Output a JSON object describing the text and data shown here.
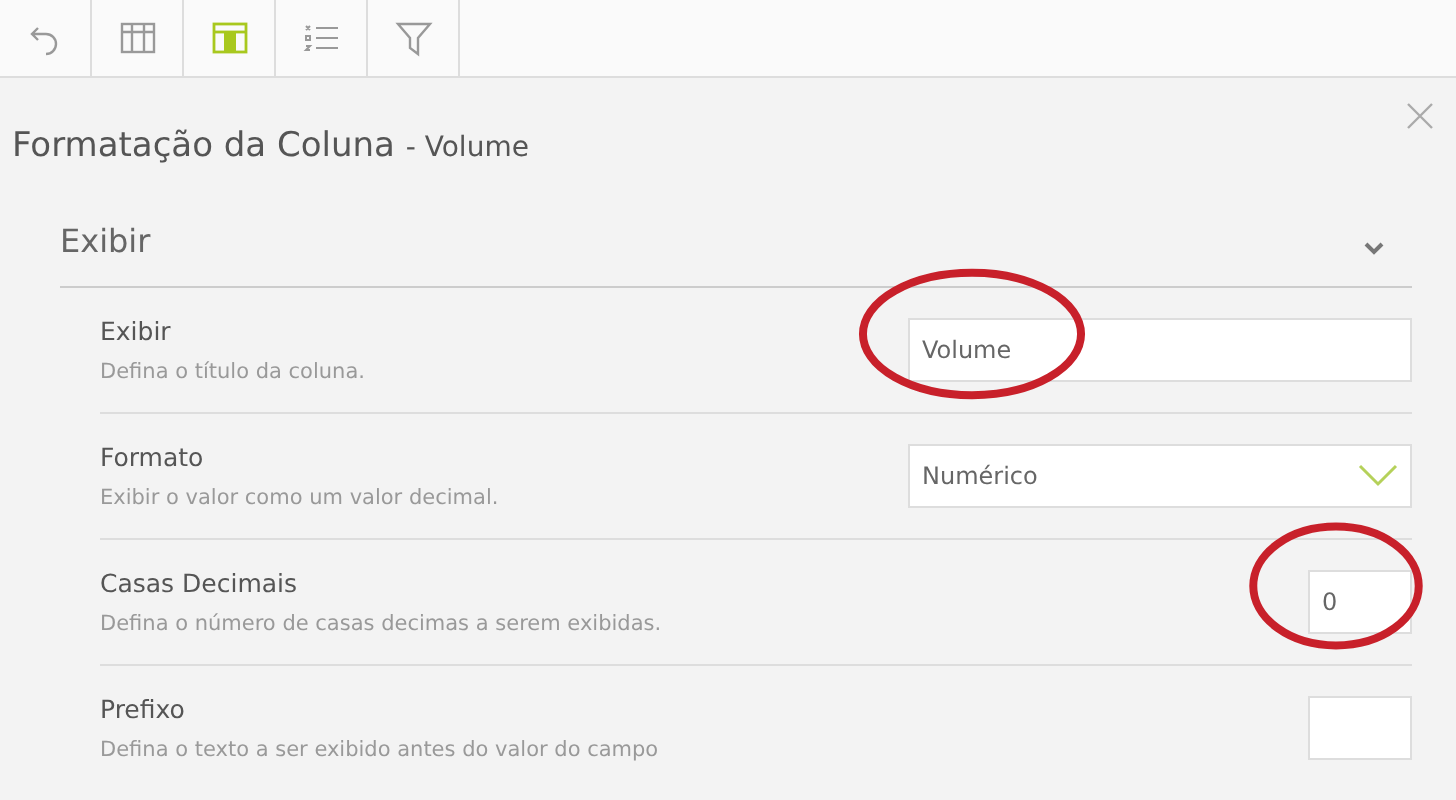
{
  "toolbar": [
    {
      "kind": "undo",
      "selected": false
    },
    {
      "kind": "table",
      "selected": false
    },
    {
      "kind": "column",
      "selected": true
    },
    {
      "kind": "list",
      "selected": false
    },
    {
      "kind": "filter",
      "selected": false
    }
  ],
  "panel": {
    "title": "Formatação da Coluna",
    "subtitle": "- Volume",
    "section": {
      "title": "Exibir",
      "expanded": true,
      "rows": [
        {
          "label": "Exibir",
          "description": "Defina o título da coluna.",
          "kind": "text",
          "value": "Volume",
          "circled": true
        },
        {
          "label": "Formato",
          "description": "Exibir o valor como um valor decimal.",
          "kind": "select",
          "value": "Numérico",
          "circled": false
        },
        {
          "label": "Casas Decimais",
          "description": "Defina o número de casas decimas a serem exibidas.",
          "kind": "number",
          "value": "0",
          "circled": true
        },
        {
          "label": "Prefixo",
          "description": "Defina o texto a ser exibido antes do valor do campo",
          "kind": "number",
          "circled": false
        }
      ]
    }
  }
}
